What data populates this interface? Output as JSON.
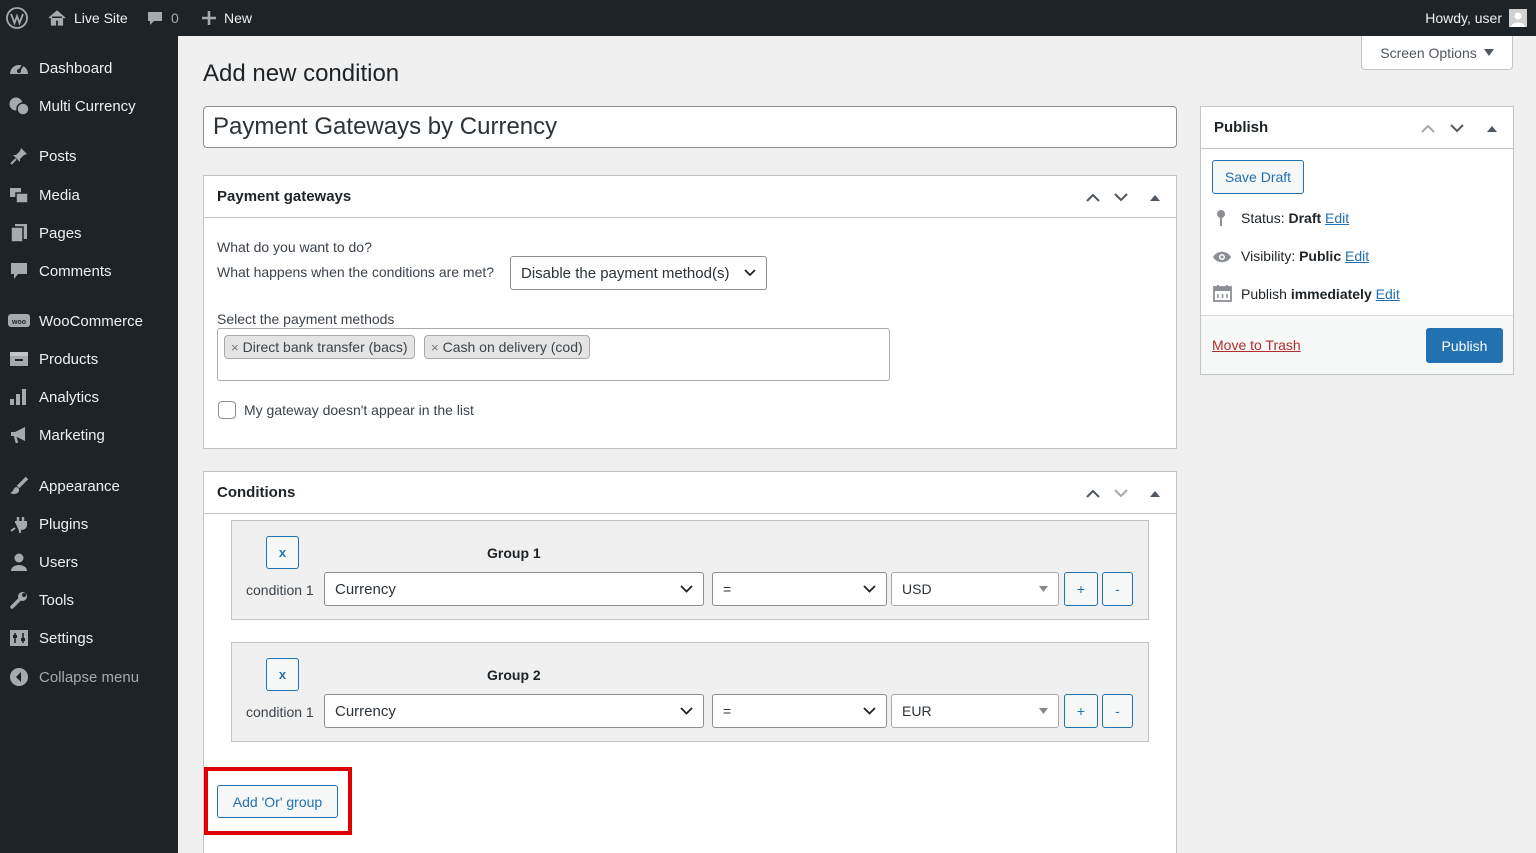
{
  "adminbar": {
    "site_name": "Live Site",
    "comments_count": "0",
    "new_label": "New",
    "howdy": "Howdy, user"
  },
  "sidebar": {
    "items": [
      {
        "label": "Dashboard",
        "icon": "dashboard-icon"
      },
      {
        "label": "Multi Currency",
        "icon": "currency-icon"
      },
      {
        "label": "Posts",
        "icon": "pin-icon"
      },
      {
        "label": "Media",
        "icon": "media-icon"
      },
      {
        "label": "Pages",
        "icon": "pages-icon"
      },
      {
        "label": "Comments",
        "icon": "comment-icon"
      },
      {
        "label": "WooCommerce",
        "icon": "woo-icon"
      },
      {
        "label": "Products",
        "icon": "products-icon"
      },
      {
        "label": "Analytics",
        "icon": "analytics-icon"
      },
      {
        "label": "Marketing",
        "icon": "megaphone-icon"
      },
      {
        "label": "Appearance",
        "icon": "brush-icon"
      },
      {
        "label": "Plugins",
        "icon": "plug-icon"
      },
      {
        "label": "Users",
        "icon": "user-icon"
      },
      {
        "label": "Tools",
        "icon": "wrench-icon"
      },
      {
        "label": "Settings",
        "icon": "settings-icon"
      },
      {
        "label": "Collapse menu",
        "icon": "collapse-icon"
      }
    ]
  },
  "screen_options": "Screen Options",
  "page_title": "Add new condition",
  "post_title": "Payment Gateways by Currency",
  "payment_box": {
    "title": "Payment gateways",
    "question": "What do you want to do?",
    "action_label": "What happens when the conditions are met?",
    "action_value": "Disable the payment method(s)",
    "methods_label": "Select the payment methods",
    "methods": [
      "Direct bank transfer (bacs)",
      "Cash on delivery (cod)"
    ],
    "chip_remove": "×",
    "checkbox_label": "My gateway doesn't appear in the list"
  },
  "conditions_box": {
    "title": "Conditions",
    "groups": [
      {
        "title": "Group 1",
        "remove": "x",
        "cond_label": "condition 1",
        "field": "Currency",
        "operator": "=",
        "value": "USD",
        "plus": "+",
        "minus": "-"
      },
      {
        "title": "Group 2",
        "remove": "x",
        "cond_label": "condition 1",
        "field": "Currency",
        "operator": "=",
        "value": "EUR",
        "plus": "+",
        "minus": "-"
      }
    ],
    "add_or_group": "Add 'Or' group"
  },
  "publish_box": {
    "title": "Publish",
    "save_draft": "Save Draft",
    "status_label": "Status:",
    "status_value": "Draft",
    "visibility_label": "Visibility:",
    "visibility_value": "Public",
    "publish_label": "Publish",
    "publish_value": "immediately",
    "edit": "Edit",
    "trash": "Move to Trash",
    "publish_button": "Publish"
  },
  "colors": {
    "accent": "#2271b1",
    "admin_bar": "#1d2327",
    "highlight_box": "#e00000",
    "trash": "#b32d2e"
  }
}
